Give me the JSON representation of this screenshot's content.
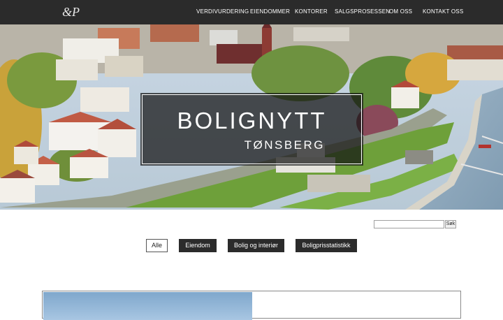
{
  "header": {
    "logo_text": "&P",
    "nav": [
      {
        "label": "VERDIVURDERING"
      },
      {
        "label": "EIENDOMMER"
      },
      {
        "label": "KONTORER"
      },
      {
        "label": "SALGSPROSESSEN"
      },
      {
        "label": "OM OSS"
      },
      {
        "label": "KONTAKT OSS"
      }
    ]
  },
  "hero": {
    "title": "BOLIGNYTT",
    "subtitle": "TØNSBERG"
  },
  "search": {
    "value": "",
    "button_label": "Søk"
  },
  "filters": [
    {
      "label": "Alle",
      "active": true
    },
    {
      "label": "Eiendom",
      "active": false
    },
    {
      "label": "Bolig og interiør",
      "active": false
    },
    {
      "label": "Boligprisstatistikk",
      "active": false
    }
  ],
  "colors": {
    "header_bg": "#2b2b2b",
    "filter_dark": "#2b2b2b",
    "text_white": "#ffffff"
  }
}
